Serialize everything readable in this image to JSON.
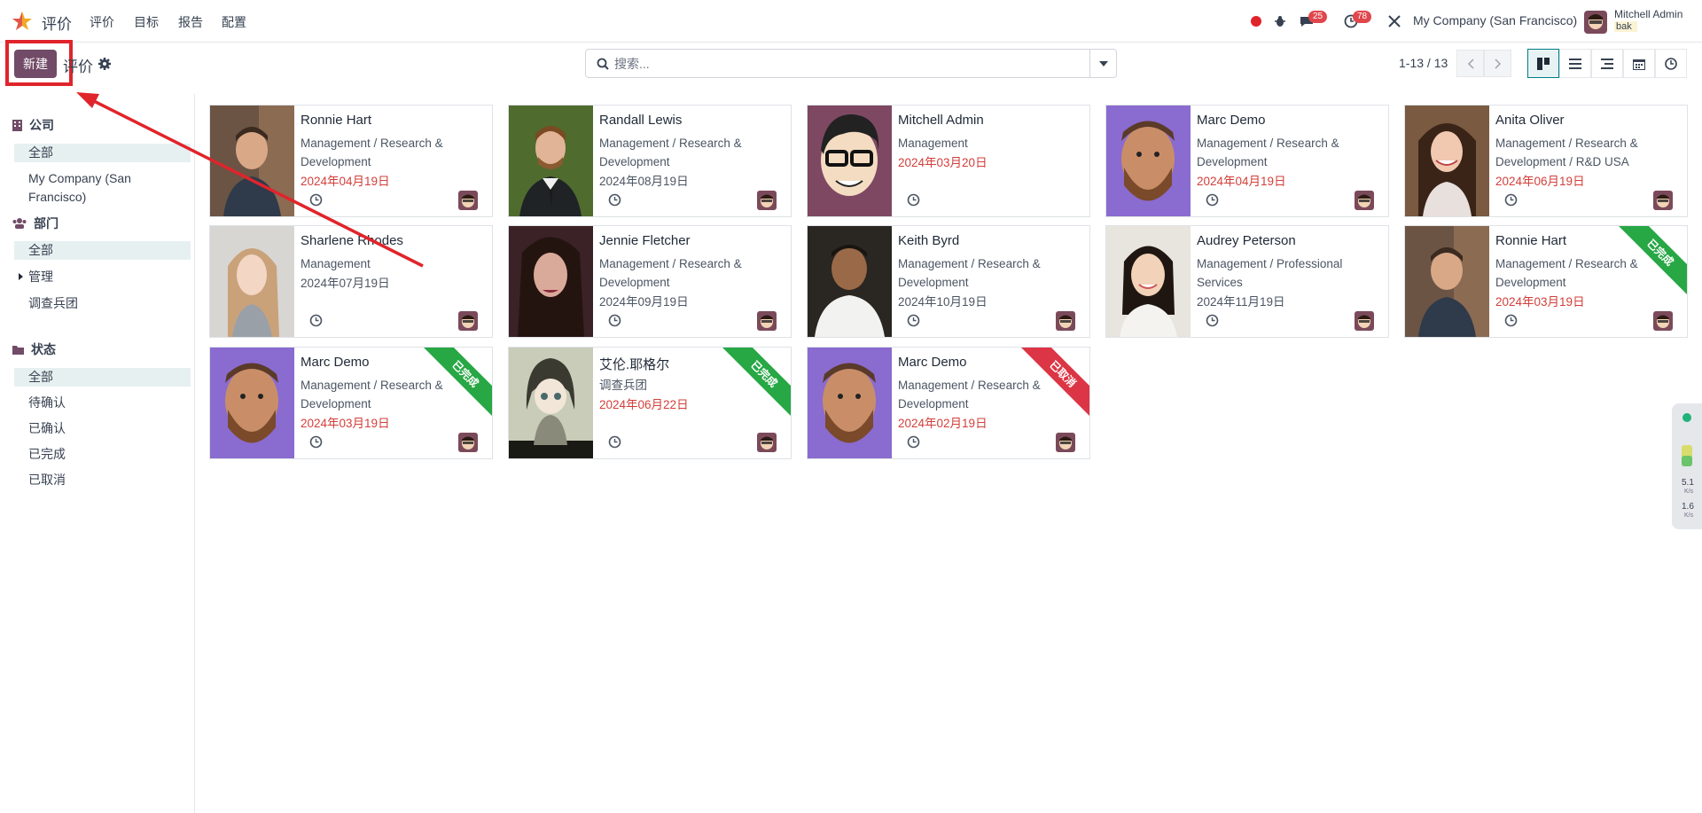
{
  "topnav": {
    "app_name": "评价",
    "menu": [
      "评价",
      "目标",
      "报告",
      "配置"
    ],
    "messages_count": "25",
    "activities_count": "78",
    "company": "My Company (San Francisco)",
    "user_name": "Mitchell Admin",
    "user_db": "bak"
  },
  "control": {
    "new_label": "新建",
    "breadcrumb": "评价",
    "search_placeholder": "搜索...",
    "pager": "1-13 / 13"
  },
  "sidebar": {
    "company_title": "公司",
    "company_items": [
      "全部",
      "My Company (San Francisco)"
    ],
    "department_title": "部门",
    "department_items": [
      "全部",
      "管理",
      "调查兵团"
    ],
    "status_title": "状态",
    "status_items": [
      "全部",
      "待确认",
      "已确认",
      "已完成",
      "已取消"
    ]
  },
  "cards": [
    {
      "name": "Ronnie Hart",
      "dept": "Management / Research & Development",
      "date": "2024年04月19日",
      "overdue": true,
      "ribbon": ""
    },
    {
      "name": "Randall Lewis",
      "dept": "Management / Research & Development",
      "date": "2024年08月19日",
      "overdue": false,
      "ribbon": ""
    },
    {
      "name": "Mitchell Admin",
      "dept": "Management",
      "date": "2024年03月20日",
      "overdue": true,
      "ribbon": ""
    },
    {
      "name": "Marc Demo",
      "dept": "Management / Research & Development",
      "date": "2024年04月19日",
      "overdue": true,
      "ribbon": ""
    },
    {
      "name": "Anita Oliver",
      "dept": "Management / Research & Development / R&D USA",
      "date": "2024年06月19日",
      "overdue": true,
      "ribbon": ""
    },
    {
      "name": "Sharlene Rhodes",
      "dept": "Management",
      "date": "2024年07月19日",
      "overdue": false,
      "ribbon": ""
    },
    {
      "name": "Jennie Fletcher",
      "dept": "Management / Research & Development",
      "date": "2024年09月19日",
      "overdue": false,
      "ribbon": ""
    },
    {
      "name": "Keith Byrd",
      "dept": "Management / Research & Development",
      "date": "2024年10月19日",
      "overdue": false,
      "ribbon": ""
    },
    {
      "name": "Audrey Peterson",
      "dept": "Management / Professional Services",
      "date": "2024年11月19日",
      "overdue": false,
      "ribbon": ""
    },
    {
      "name": "Ronnie Hart",
      "dept": "Management / Research & Development",
      "date": "2024年03月19日",
      "overdue": true,
      "ribbon": "已完成"
    },
    {
      "name": "Marc Demo",
      "dept": "Management / Research & Development",
      "date": "2024年03月19日",
      "overdue": true,
      "ribbon": "已完成"
    },
    {
      "name": "艾伦.耶格尔",
      "dept": "调查兵团",
      "date": "2024年06月22日",
      "overdue": true,
      "ribbon": "已完成"
    },
    {
      "name": "Marc Demo",
      "dept": "Management / Research & Development",
      "date": "2024年02月19日",
      "overdue": true,
      "ribbon": "已取消"
    }
  ],
  "widget": {
    "up": "5.1",
    "down": "1.6",
    "unit": "K/s"
  }
}
